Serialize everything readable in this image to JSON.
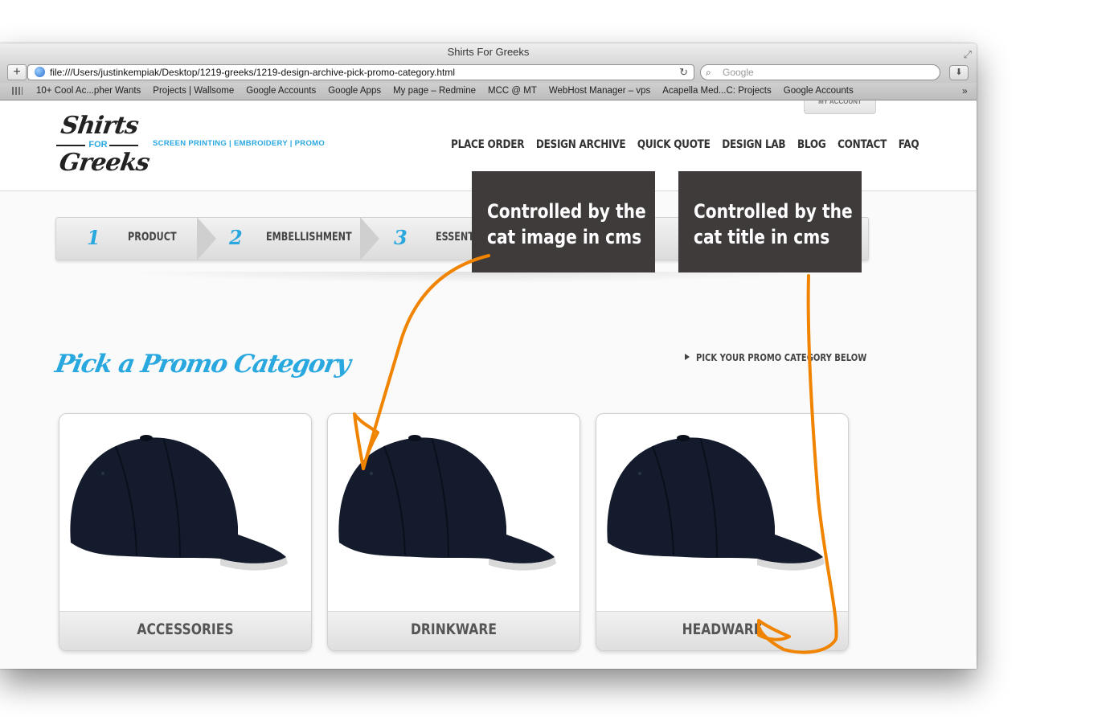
{
  "window_title": "Shirts For Greeks",
  "toolbar": {
    "add_label": "+",
    "url": "file:///Users/justinkempiak/Desktop/1219-greeks/1219-design-archive-pick-promo-category.html",
    "search_placeholder": "Google"
  },
  "bookmarks": [
    "10+ Cool Ac...pher Wants",
    "Projects | Wallsome",
    "Google Accounts",
    "Google Apps",
    "My page – Redmine",
    "MCC @ MT",
    "WebHost Manager – vps",
    "Acapella Med...C: Projects",
    "Google Accounts"
  ],
  "logo": {
    "line1": "Shirts",
    "line2": "FOR",
    "line3": "Greeks"
  },
  "tagline": "SCREEN PRINTING  |  EMBROIDERY  |  PROMO",
  "my_account": "MY ACCOUNT",
  "nav": [
    "PLACE ORDER",
    "DESIGN ARCHIVE",
    "QUICK QUOTE",
    "DESIGN LAB",
    "BLOG",
    "CONTACT",
    "FAQ"
  ],
  "steps": [
    {
      "num": "1",
      "label": "PRODUCT"
    },
    {
      "num": "2",
      "label": "EMBELLISHMENT"
    },
    {
      "num": "3",
      "label": "ESSENTI"
    }
  ],
  "page_title": "Pick a Promo Category",
  "page_hint": "PICK YOUR PROMO CATEGORY BELOW",
  "categories": [
    {
      "title": "ACCESSORIES"
    },
    {
      "title": "DRINKWARE"
    },
    {
      "title": "HEADWARE"
    }
  ],
  "annotations": [
    {
      "line1": "Controlled by the",
      "line2": "cat image in cms"
    },
    {
      "line1": "Controlled by the",
      "line2": "cat title in cms"
    }
  ],
  "colors": {
    "accent": "#29a8df",
    "annotation_box": "#3f3b3b",
    "annotation_arrow": "#f08400"
  }
}
